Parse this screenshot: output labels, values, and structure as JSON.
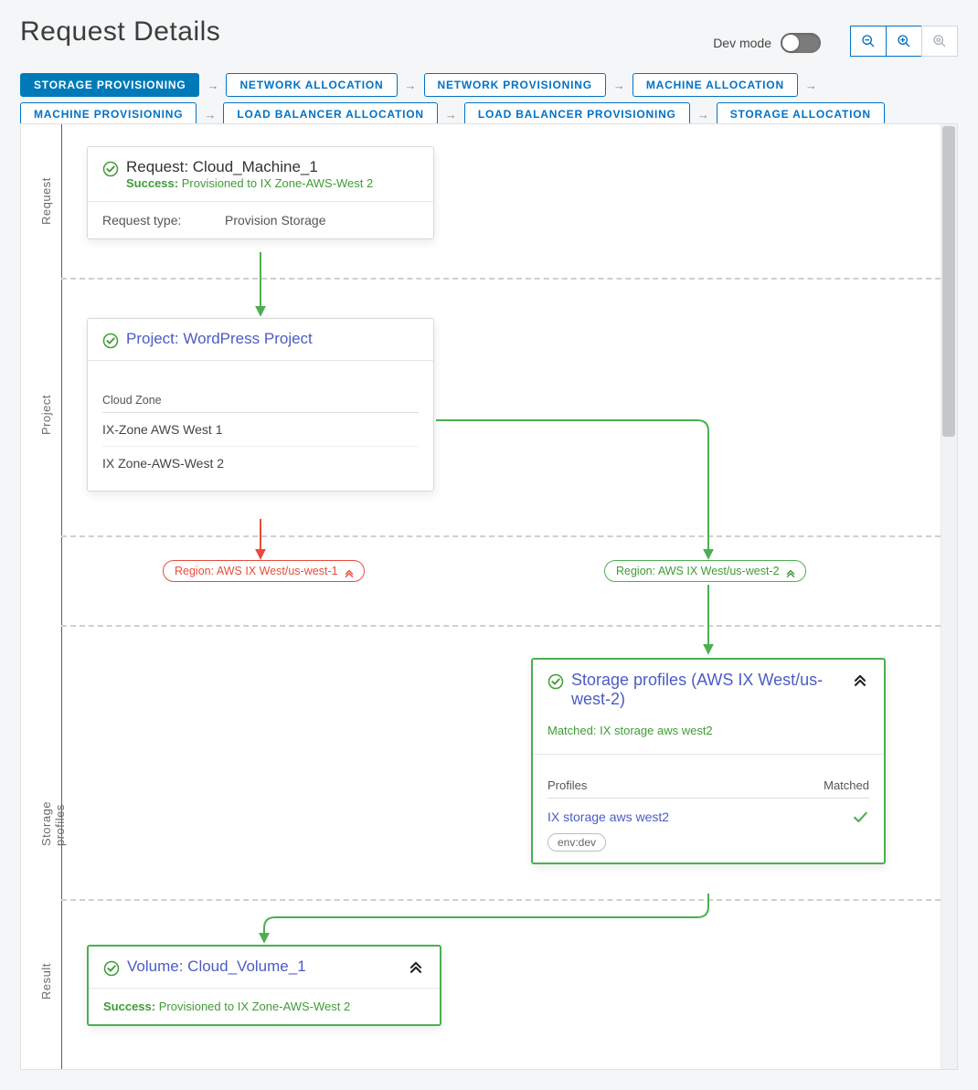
{
  "title": "Request Details",
  "dev_mode_label": "Dev mode",
  "dev_mode_on": false,
  "steps": [
    {
      "label": "STORAGE PROVISIONING",
      "active": true
    },
    {
      "label": "NETWORK ALLOCATION"
    },
    {
      "label": "NETWORK PROVISIONING"
    },
    {
      "label": "MACHINE ALLOCATION"
    },
    {
      "label": "MACHINE PROVISIONING"
    },
    {
      "label": "LOAD BALANCER ALLOCATION"
    },
    {
      "label": "LOAD BALANCER PROVISIONING"
    },
    {
      "label": "STORAGE ALLOCATION"
    }
  ],
  "rows": {
    "request": "Request",
    "project": "Project",
    "storage_profiles": "Storage profiles",
    "result": "Result"
  },
  "request_card": {
    "title": "Request: Cloud_Machine_1",
    "status_prefix": "Success:",
    "status_msg": "Provisioned to IX Zone-AWS-West 2",
    "request_type_label": "Request type:",
    "request_type_value": "Provision Storage"
  },
  "project_card": {
    "title_prefix": "Project:",
    "title_link": "WordPress Project",
    "section_label": "Cloud Zone",
    "zones": [
      "IX-Zone AWS West 1",
      "IX Zone-AWS-West 2"
    ]
  },
  "regions": {
    "left": "Region: AWS IX West/us-west-1",
    "right": "Region: AWS IX West/us-west-2"
  },
  "storage_card": {
    "title": "Storage profiles (AWS IX West/us-west-2)",
    "matched_prefix": "Matched:",
    "matched_value": "IX storage aws west2",
    "col_profiles": "Profiles",
    "col_matched": "Matched",
    "row_name": "IX storage aws west2",
    "row_chip": "env:dev"
  },
  "result_card": {
    "title_prefix": "Volume:",
    "title_link": "Cloud_Volume_1",
    "status_prefix": "Success:",
    "status_msg": "Provisioned to IX Zone-AWS-West 2"
  }
}
